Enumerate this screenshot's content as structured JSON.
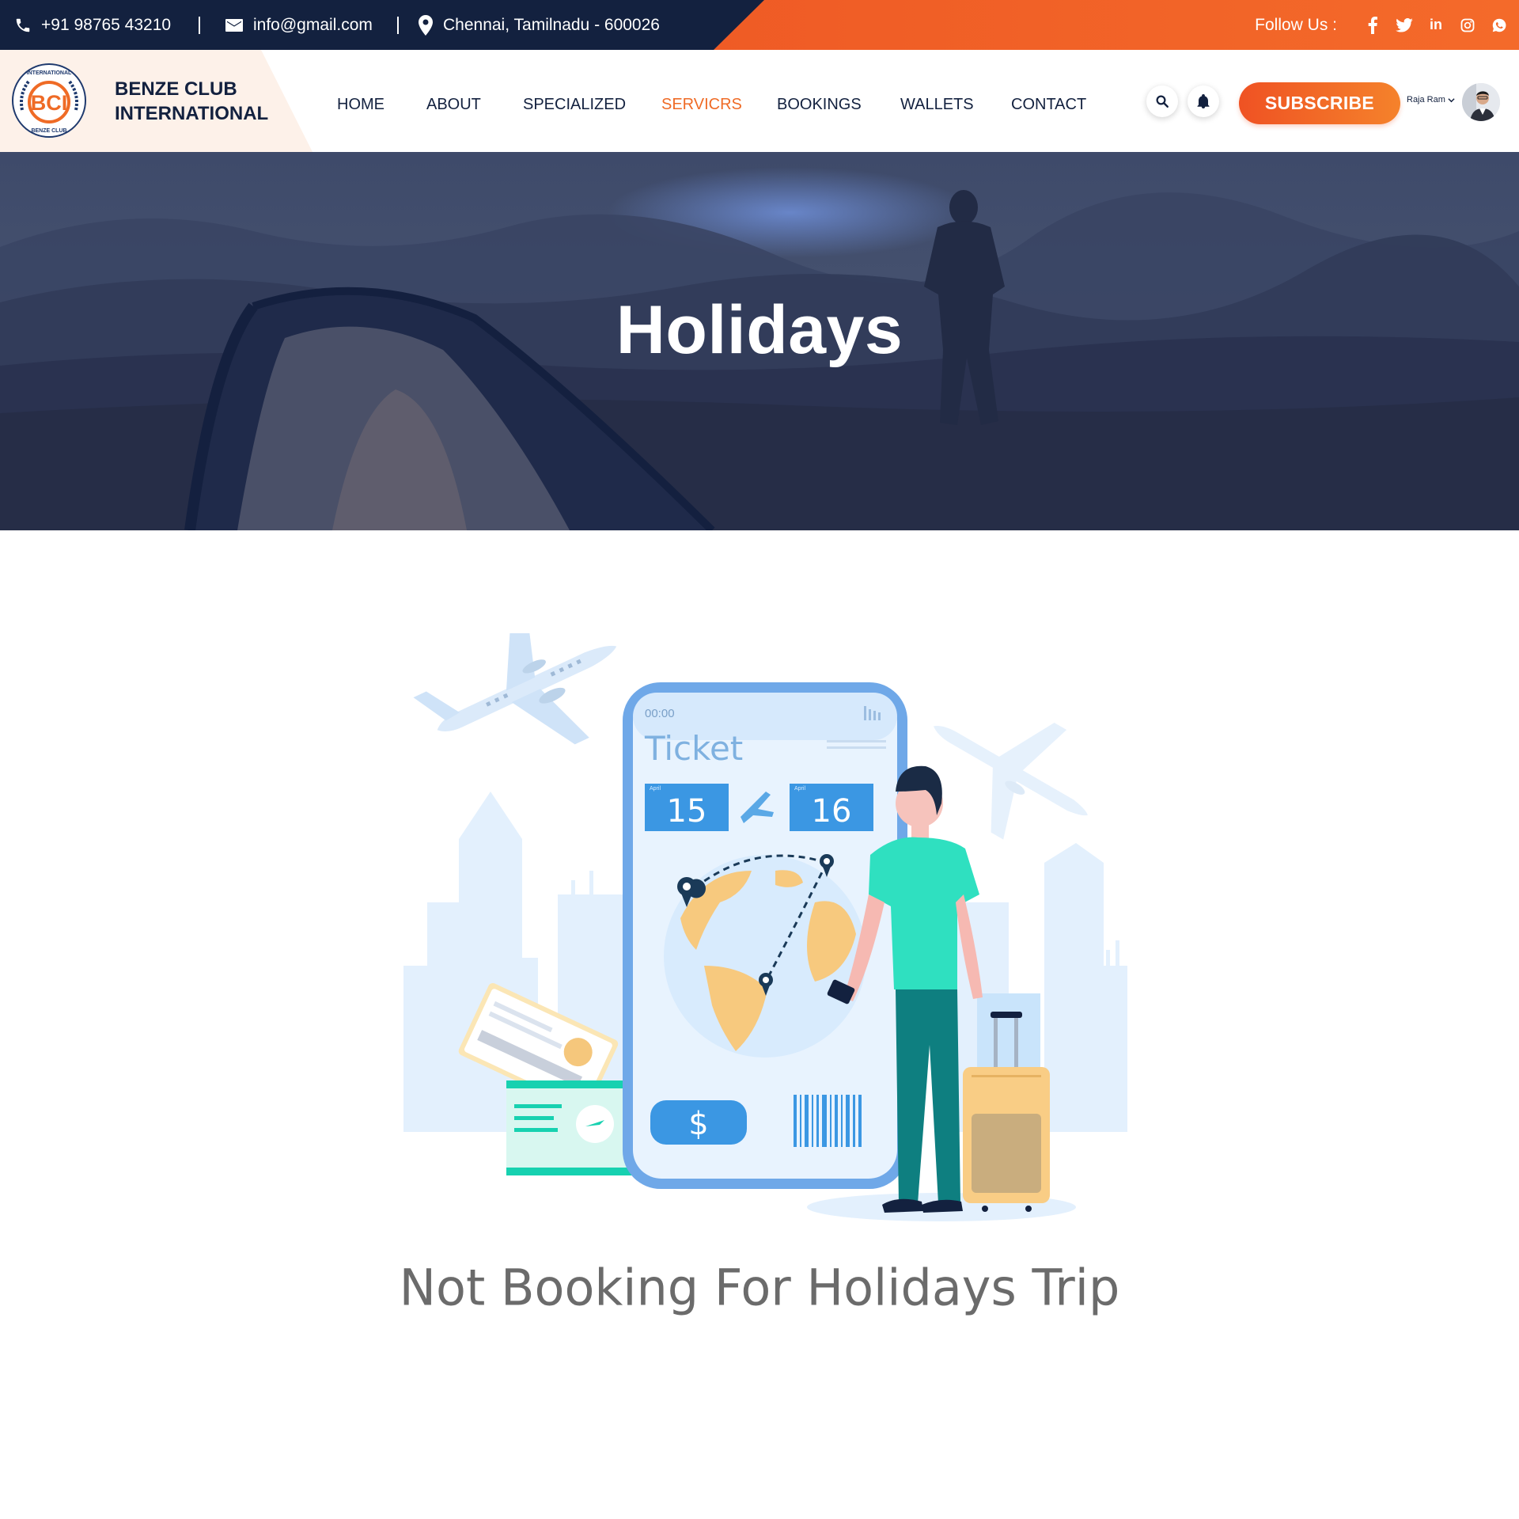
{
  "topbar": {
    "phone": "+91 98765 43210",
    "email": "info@gmail.com",
    "address": "Chennai, Tamilnadu - 600026",
    "follow_label": "Follow Us :",
    "social": [
      "facebook-icon",
      "twitter-icon",
      "linkedin-icon",
      "instagram-icon",
      "whatsapp-icon"
    ]
  },
  "brand": {
    "line1": "BENZE CLUB",
    "line2": "INTERNATIONAL",
    "emblem_text_top": "INTERNATIONAL",
    "emblem_text_bottom": "BENZE CLUB",
    "emblem_initials": "BCI"
  },
  "nav": {
    "items": [
      {
        "label": "HOME"
      },
      {
        "label": "ABOUT"
      },
      {
        "label": "SPECIALIZED"
      },
      {
        "label": "SERVICRS",
        "active": true
      },
      {
        "label": "BOOKINGS"
      },
      {
        "label": "WALLETS"
      },
      {
        "label": "CONTACT"
      }
    ],
    "subscribe_label": "SUBSCRIBE",
    "user_name": "Raja Ram"
  },
  "hero": {
    "title": "Holidays"
  },
  "illustration": {
    "phone_time": "00:00",
    "ticket_label": "Ticket",
    "date_from_month": "April",
    "date_from": "15",
    "date_to_month": "April",
    "date_to": "16",
    "currency": "$"
  },
  "empty_state": {
    "message": "Not Booking For Holidays Trip"
  },
  "colors": {
    "navy": "#13213f",
    "orange": "#ef5b25",
    "active_nav": "#ef6b26"
  }
}
